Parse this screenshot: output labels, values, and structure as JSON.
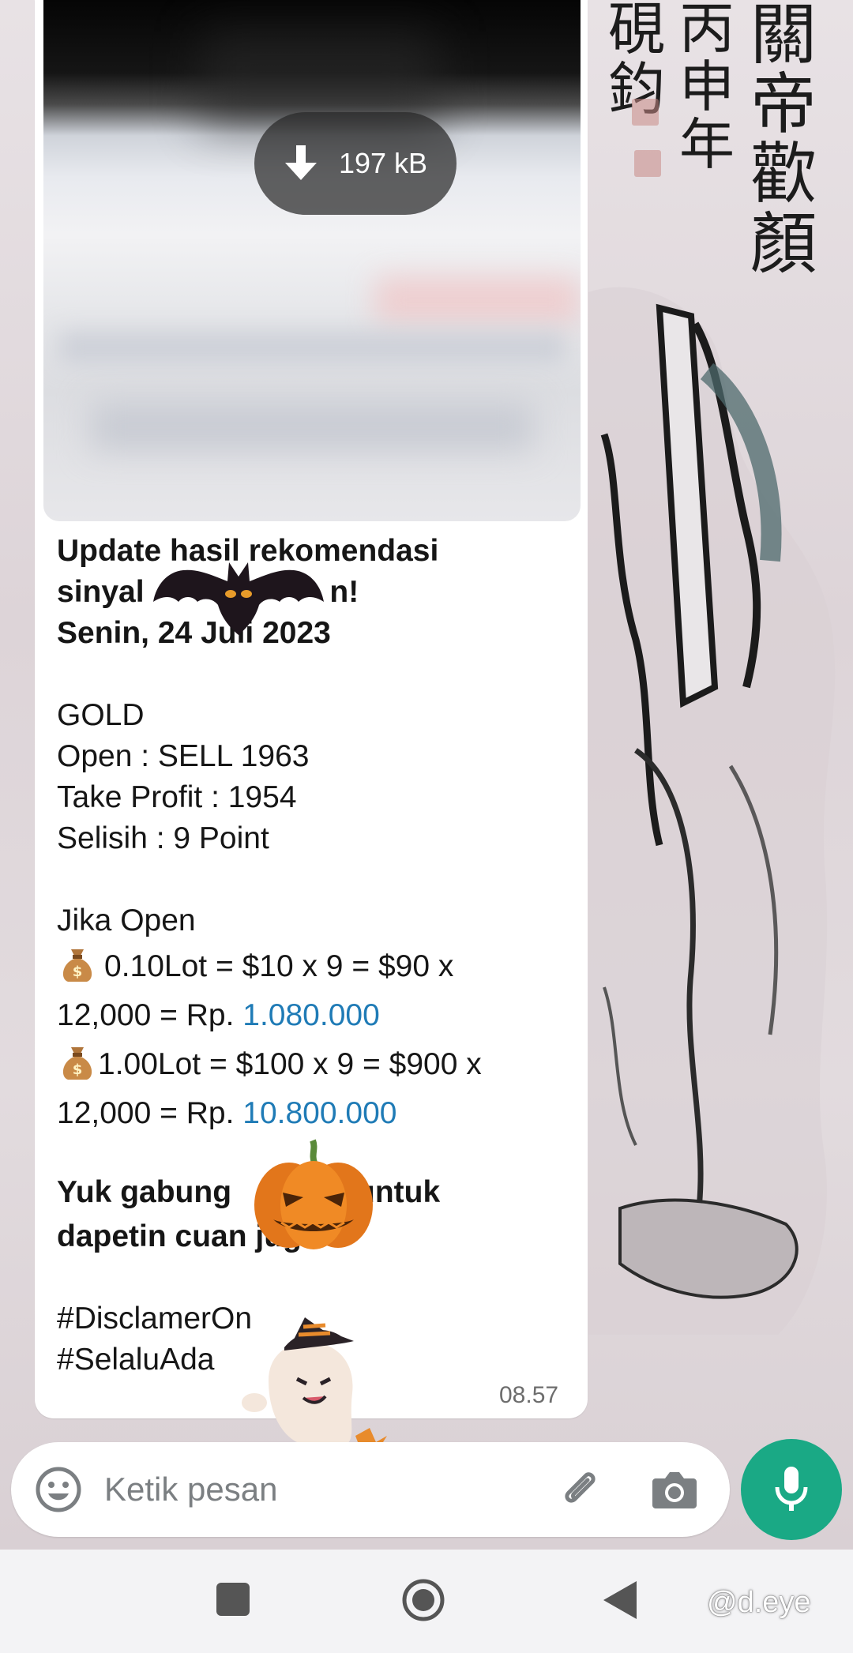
{
  "media": {
    "size_label": "197 kB"
  },
  "message": {
    "headline_line1": "Update hasil rekomendasi",
    "headline_line2_prefix": "sinyal",
    "headline_line2_suffix": "n!",
    "date_line": "Senin, 24 Juli 2023",
    "asset": "GOLD",
    "open_line": "Open : SELL 1963",
    "take_profit_line": "Take Profit : 1954",
    "selisih_line": "Selisih : 9 Point",
    "jika_open": "Jika Open",
    "lot1_line": "0.10Lot = $10 x 9 = $90 x",
    "lot1_result_prefix": "12,000 = Rp. ",
    "lot1_result_value": "1.080.000",
    "lot2_line": "1.00Lot = $100 x 9 = $900 x",
    "lot2_result_prefix": "12,000 = Rp. ",
    "lot2_result_value": "10.800.000",
    "cta_line1_prefix": "Yuk gabung",
    "cta_line1_suffix": "untuk",
    "cta_line2": "dapetin cuan juga",
    "hashtag1": "#DisclamerOn",
    "hashtag2": "#SelaluAda",
    "time": "08.57"
  },
  "input_bar": {
    "placeholder": "Ketik pesan"
  },
  "watermark": "@d.eye",
  "colors": {
    "link": "#1f7bb6",
    "mic_button": "#1aa985",
    "bubble": "#ffffff"
  },
  "icons": {
    "emoji": "emoji-icon",
    "attach": "paperclip-icon",
    "camera": "camera-icon",
    "mic": "microphone-icon",
    "download": "download-arrow-icon",
    "moneybag": "money-bag-icon"
  }
}
